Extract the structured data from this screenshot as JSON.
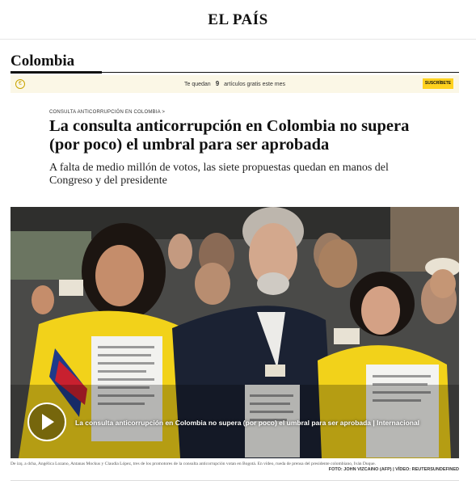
{
  "header": {
    "logo": "EL PAÍS"
  },
  "section": {
    "title": "Colombia"
  },
  "paywall": {
    "icon": "coin-icon",
    "text_before": "Te quedan",
    "count": "9",
    "text_after": "artículos gratis este mes",
    "button": "SUSCRÍBETE"
  },
  "article": {
    "kicker": "CONSULTA ANTICORRUPCIÓN EN COLOMBIA >",
    "headline": "La consulta anticorrupción en Colombia no supera (por poco) el umbral para ser aprobada",
    "subhead": "A falta de medio millón de votos, las siete propuestas quedan en manos del Congreso y del presidente"
  },
  "video": {
    "title": "La consulta anticorrupción en Colombia no supera (por poco) el umbral para ser aprobada | Internacional",
    "play_icon": "play-icon"
  },
  "caption": {
    "text": "De izq. a dcha, Angélica Lozano, Antanas Mockus y Claudia López, tres de los promotores de la consulta anticorrupción votan en Bogotá. En vídeo, rueda de prensa del presidente colombiano, Iván Duque.",
    "credit": "FOTO: JOHN VIZCAINO (AFP) | VÍDEO: REUTERSUNDEFINED"
  }
}
